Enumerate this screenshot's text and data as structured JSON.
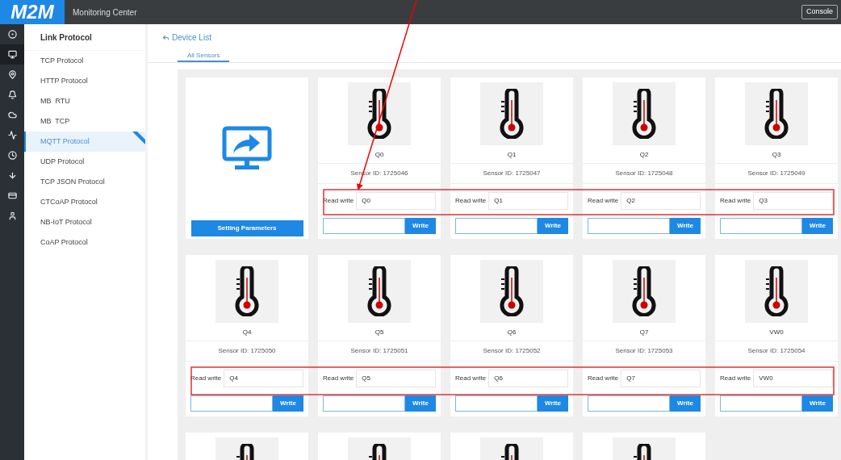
{
  "header": {
    "logo": "M2M",
    "title": "Monitoring Center",
    "console_button": "Console"
  },
  "rail": [
    {
      "kind": "target",
      "selected": false
    },
    {
      "kind": "monitor",
      "selected": true
    },
    {
      "kind": "pin",
      "selected": false
    },
    {
      "kind": "bell",
      "selected": false
    },
    {
      "kind": "cloud",
      "selected": false
    },
    {
      "kind": "wave",
      "selected": false
    },
    {
      "kind": "clock",
      "selected": false
    },
    {
      "kind": "download",
      "selected": false
    },
    {
      "kind": "card",
      "selected": false
    },
    {
      "kind": "user",
      "selected": false
    }
  ],
  "sidebar": {
    "title": "Link Protocol",
    "items": [
      {
        "label": "TCP Protocol",
        "selected": false
      },
      {
        "label": "HTTP Protocol",
        "selected": false
      },
      {
        "label": "MB  RTU",
        "selected": false
      },
      {
        "label": "MB  TCP",
        "selected": false
      },
      {
        "label": "MQTT Protocol",
        "selected": true
      },
      {
        "label": "UDP Protocol",
        "selected": false
      },
      {
        "label": "TCP JSON Protocol",
        "selected": false
      },
      {
        "label": "CTCoAP Protocol",
        "selected": false
      },
      {
        "label": "NB-IoT Protocol",
        "selected": false
      },
      {
        "label": "CoAP Protocol",
        "selected": false
      }
    ]
  },
  "back_link": "Device List",
  "tabs": [
    {
      "label": "All Sensors",
      "selected": true
    }
  ],
  "settings_card": {
    "button": "Setting Parameters"
  },
  "sensors": [
    {
      "kind": "full",
      "name": "Q0",
      "sensor_id": "Sensor ID: 1725046",
      "read_write_label": "Read write",
      "read_write_value": "Q0",
      "write_button": "Write"
    },
    {
      "kind": "full",
      "name": "Q1",
      "sensor_id": "Sensor ID: 1725047",
      "read_write_label": "Read write",
      "read_write_value": "Q1",
      "write_button": "Write"
    },
    {
      "kind": "full",
      "name": "Q2",
      "sensor_id": "Sensor ID: 1725048",
      "read_write_label": "Read write",
      "read_write_value": "Q2",
      "write_button": "Write"
    },
    {
      "kind": "full",
      "name": "Q3",
      "sensor_id": "Sensor ID: 1725049",
      "read_write_label": "Read write",
      "read_write_value": "Q3",
      "write_button": "Write"
    },
    {
      "kind": "full",
      "name": "Q4",
      "sensor_id": "Sensor ID: 1725050",
      "read_write_label": "Read write",
      "read_write_value": "Q4",
      "write_button": "Write"
    },
    {
      "kind": "full",
      "name": "Q5",
      "sensor_id": "Sensor ID: 1725051",
      "read_write_label": "Read write",
      "read_write_value": "Q5",
      "write_button": "Write"
    },
    {
      "kind": "full",
      "name": "Q6",
      "sensor_id": "Sensor ID: 1725052",
      "read_write_label": "Read write",
      "read_write_value": "Q6",
      "write_button": "Write"
    },
    {
      "kind": "full",
      "name": "Q7",
      "sensor_id": "Sensor ID: 1725053",
      "read_write_label": "Read write",
      "read_write_value": "Q7",
      "write_button": "Write"
    },
    {
      "kind": "full",
      "name": "VW0",
      "sensor_id": "Sensor ID: 1725054",
      "read_write_label": "Read write",
      "read_write_value": "VW0",
      "write_button": "Write"
    },
    {
      "kind": "cut_off"
    },
    {
      "kind": "cut_off"
    },
    {
      "kind": "cut_off"
    },
    {
      "kind": "cut_off"
    }
  ]
}
